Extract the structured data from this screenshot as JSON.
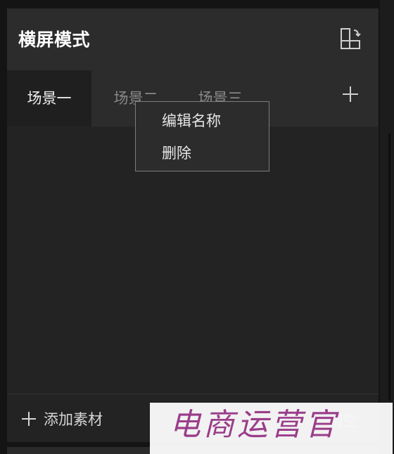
{
  "panel": {
    "title": "横屏模式",
    "orientation_icon": "orientation-switch-icon"
  },
  "tabs": [
    {
      "label": "场景一",
      "active": true
    },
    {
      "label": "场景二",
      "active": false
    },
    {
      "label": "场景三",
      "active": false
    }
  ],
  "add_scene_icon": "plus-icon",
  "context_menu": {
    "items": [
      {
        "label": "编辑名称"
      },
      {
        "label": "删除"
      }
    ]
  },
  "footer": {
    "add_material_label": "添加素材",
    "add_material_icon": "plus-icon",
    "clear_label": "清空"
  },
  "watermark": {
    "text": "电商运营官"
  }
}
